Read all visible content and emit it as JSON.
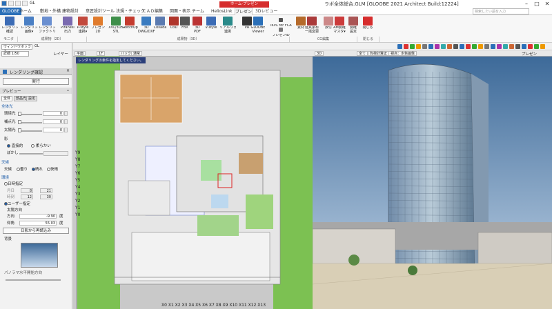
{
  "window": {
    "title": "ラボ全体総合.GLM [GLOOBE 2021 Architect Build:12224]",
    "qat_extra": "GL"
  },
  "tabs": {
    "globe": "GLOOBE",
    "items": [
      "ホーム",
      "敷地・外構",
      "建物設計",
      "意匠設計ツール",
      "法規・チェック",
      "ＣＡＤ編集",
      "図面・表示",
      "チーム",
      "HeliosLink",
      "プレゼン",
      "3Dレビュー"
    ],
    "context_band": "ホーム-プレゼン",
    "search_placeholder": "検索したい語を入力"
  },
  "ribbon": {
    "buttons": [
      {
        "label": "レンダリング\n確認",
        "color": "#3b6bb5"
      },
      {
        "label": "レンダリング\n画像▾",
        "color": "#4a7fc4"
      },
      {
        "label": "レンダリング\nファクトリー▾",
        "color": "#6a8fd0"
      },
      {
        "label": "Piranesi\n出力",
        "color": "#7a6ab0"
      },
      {
        "label": "P-style\n連携▾",
        "color": "#c2493d"
      },
      {
        "label": "プレゼン\n2D",
        "color": "#e07b2c"
      },
      {
        "label": "XVL/3DS\nSTL",
        "color": "#3e8f4a"
      },
      {
        "label": "SketchUp",
        "color": "#c43b2e"
      },
      {
        "label": "3D\nDWG/DXF",
        "color": "#3a7bc0"
      },
      {
        "label": "Collada",
        "color": "#5a7ab0"
      },
      {
        "label": "U3D",
        "color": "#b0352b"
      },
      {
        "label": "FBX",
        "color": "#555"
      },
      {
        "label": "3D\nPDF",
        "color": "#b33"
      },
      {
        "label": "V-style",
        "color": "#3b6bb5"
      },
      {
        "label": "リアルウォーク\n連携",
        "color": "#2a8a8a"
      },
      {
        "label": "VR",
        "color": "#333"
      },
      {
        "label": "GLOOBE\nViewer",
        "color": "#2a6fb8"
      },
      {
        "label": "iKVL for FCA",
        "color": "#555"
      },
      {
        "label": "プレゼンID",
        "color": "#777"
      },
      {
        "label": "素材",
        "color": "#b56a2a"
      },
      {
        "label": "建具素材\n一括変更",
        "color": "#aa3a3a"
      },
      {
        "label": "数付",
        "color": "#c88"
      },
      {
        "label": "AM要確\nマスタ▾",
        "color": "#cc3b3b"
      },
      {
        "label": "要確\n設定",
        "color": "#a55"
      },
      {
        "label": "閉じる",
        "color": "#d62d2d"
      }
    ],
    "groups": [
      "モニタ",
      "成果物（2D）",
      "成果物（3D）",
      "CG編集",
      "閉じる"
    ]
  },
  "palette": {
    "dropdown": "ウィンドウボックス",
    "dropdown_note": "GL",
    "detail": "詳細 1/50",
    "layer": "レイヤー",
    "panel_title": "レンダリング確認",
    "run_button": "実行",
    "preview": "プレビュー",
    "subtabs": [
      "全体",
      "部品光",
      "設定"
    ],
    "section_overall": "全体光",
    "sliders": [
      {
        "label": "環境光",
        "value": "0"
      },
      {
        "label": "補点光",
        "value": "0"
      },
      {
        "label": "太陽光",
        "value": "0"
      }
    ],
    "shadow_label": "影",
    "shadow_options": [
      "直接的",
      "柔らかい"
    ],
    "blur_label": "ぼかし",
    "section_sky": "天候",
    "sky_label": "天候",
    "sky_options": [
      "曇り",
      "晴れ",
      "快晴"
    ],
    "section_env": "環境",
    "env_datetime": "日時指定",
    "date_labels": [
      "月日",
      "時刻"
    ],
    "date_values": [
      "8",
      "21",
      "12",
      "30"
    ],
    "env_user": "ユーザー指定",
    "sun_dir": "太陽方向",
    "azimuth_label": "方向",
    "azimuth_value": "-9.90",
    "altitude_label": "仰角",
    "altitude_value": "55.03",
    "deg": "度",
    "shadow_btn": "日影から再読込み",
    "bg_label": "背景",
    "horizon_label": "パノラマ水平開始方向"
  },
  "view2d": {
    "tab_flat": "平面",
    "floor": "1F",
    "back": "バック",
    "normal": "通常",
    "banner": "レンダリングの条件を指定してください。",
    "y_axes": [
      "Y9",
      "Y8",
      "Y7",
      "Y6",
      "Y5",
      "Y4",
      "Y3",
      "Y2",
      "Y1",
      "Y0"
    ],
    "x_axes": "X0 X1 X2 X3 X4 X5 X6 X7 X8 X9 X10 X11 X12 X13"
  },
  "view3d": {
    "tab": "3D",
    "buttons": [
      "全て",
      "負荷計算正",
      "視点：水色画像"
    ],
    "presen": "プレゼン",
    "sky_top": "#3d6a99",
    "sky_bottom": "#c7d8ea"
  }
}
